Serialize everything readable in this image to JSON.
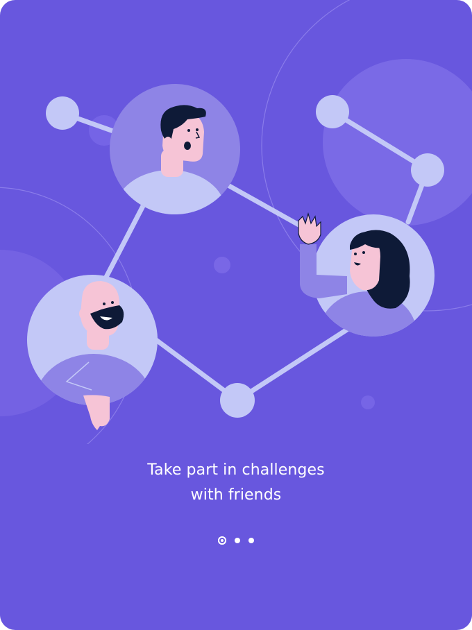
{
  "onboarding": {
    "title_line1": "Take part in challenges",
    "title_line2": "with friends",
    "illustration": "friends-network-illustration",
    "page_count": 3,
    "active_page": 1
  },
  "colors": {
    "background": "#6857DE",
    "node": "#C3C8F7",
    "circle": "#8F84E6",
    "text": "#FFFFFF"
  }
}
